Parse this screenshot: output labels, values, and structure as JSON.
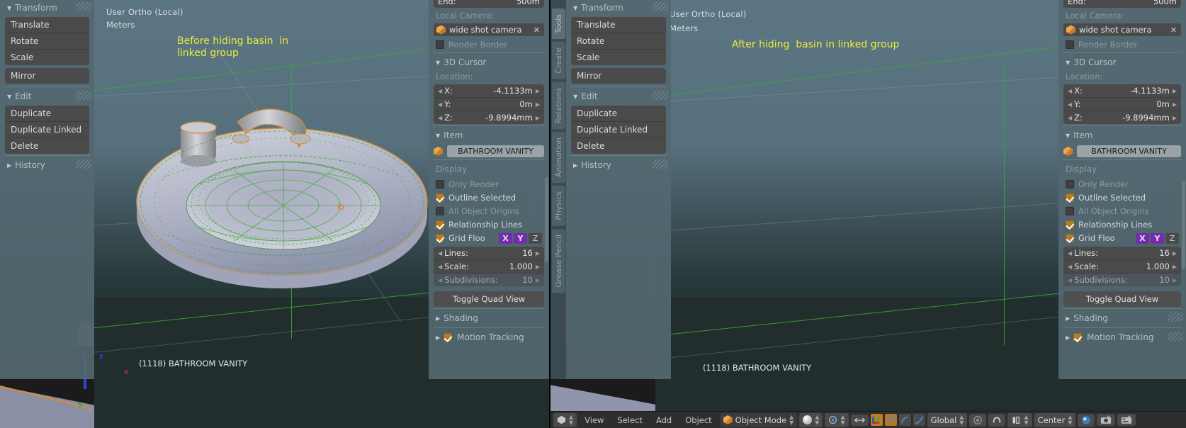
{
  "panes": [
    {
      "id": "before",
      "viewport": {
        "view_label": "User Ortho (Local)",
        "units": "Meters",
        "annotation": "Before hiding basin  in\nlinked group",
        "annotation_color": "#ecec3c",
        "object_label": "(1118) BATHROOM VANITY"
      },
      "left_panel": {
        "transform": {
          "title": "Transform",
          "buttons": [
            "Translate",
            "Rotate",
            "Scale"
          ],
          "extra_button": "Mirror"
        },
        "edit": {
          "title": "Edit",
          "buttons": [
            "Duplicate",
            "Duplicate Linked",
            "Delete"
          ]
        },
        "history": {
          "title": "History"
        }
      },
      "right_panel": {
        "clip_end": {
          "label": "End:",
          "value": "500m"
        },
        "local_camera": {
          "label": "Local Camera:",
          "value": "wide shot camera"
        },
        "render_border": {
          "label": "Render Border",
          "checked": false
        },
        "cursor": {
          "title": "3D Cursor",
          "location_label": "Location:",
          "fields": [
            {
              "label": "X:",
              "value": "-4.1133m"
            },
            {
              "label": "Y:",
              "value": "0m"
            },
            {
              "label": "Z:",
              "value": "-9.8994mm"
            }
          ]
        },
        "item": {
          "title": "Item",
          "name": "BATHROOM VANITY"
        },
        "display": {
          "title": "Display",
          "checks": [
            {
              "label": "Only Render",
              "checked": false,
              "dim": true
            },
            {
              "label": "Outline Selected",
              "checked": true,
              "dim": false
            },
            {
              "label": "All Object Origins",
              "checked": false,
              "dim": true
            },
            {
              "label": "Relationship Lines",
              "checked": true,
              "dim": false
            }
          ],
          "grid_floor": {
            "label": "Grid Floo",
            "checked": true,
            "axes": [
              "X",
              "Y",
              "Z"
            ],
            "axes_on": [
              "X",
              "Y"
            ]
          },
          "fields": [
            {
              "label": "Lines:",
              "value": "16",
              "dim": false
            },
            {
              "label": "Scale:",
              "value": "1.000",
              "dim": false
            },
            {
              "label": "Subdivisions:",
              "value": "10",
              "dim": true
            }
          ],
          "toggle_quad_view": "Toggle Quad View"
        },
        "shading": {
          "title": "Shading"
        },
        "motion_tracking": {
          "title": "Motion Tracking",
          "checked": true
        }
      }
    },
    {
      "id": "after",
      "viewport": {
        "view_label": "User Ortho (Local)",
        "units": "Meters",
        "annotation": "After hiding  basin in linked group",
        "annotation_color": "#ecec3c",
        "object_label": "(1118) BATHROOM VANITY"
      },
      "tabs": [
        {
          "label": "Tools",
          "active": true
        },
        {
          "label": "Create",
          "active": false
        },
        {
          "label": "Relations",
          "active": false
        },
        {
          "label": "Animation",
          "active": false
        },
        {
          "label": "Physics",
          "active": false
        },
        {
          "label": "Grease Pencil",
          "active": false
        }
      ],
      "left_panel": {
        "transform": {
          "title": "Transform",
          "buttons": [
            "Translate",
            "Rotate",
            "Scale"
          ],
          "extra_button": "Mirror"
        },
        "edit": {
          "title": "Edit",
          "buttons": [
            "Duplicate",
            "Duplicate Linked",
            "Delete"
          ]
        },
        "history": {
          "title": "History"
        }
      },
      "right_panel": {
        "clip_end": {
          "label": "End:",
          "value": "500m"
        },
        "local_camera": {
          "label": "Local Camera:",
          "value": "wide shot camera"
        },
        "render_border": {
          "label": "Render Border",
          "checked": false
        },
        "cursor": {
          "title": "3D Cursor",
          "location_label": "Location:",
          "fields": [
            {
              "label": "X:",
              "value": "-4.1133m"
            },
            {
              "label": "Y:",
              "value": "0m"
            },
            {
              "label": "Z:",
              "value": "-9.8994mm"
            }
          ]
        },
        "item": {
          "title": "Item",
          "name": "BATHROOM VANITY"
        },
        "display": {
          "title": "Display",
          "checks": [
            {
              "label": "Only Render",
              "checked": false,
              "dim": true
            },
            {
              "label": "Outline Selected",
              "checked": true,
              "dim": false
            },
            {
              "label": "All Object Origins",
              "checked": false,
              "dim": true
            },
            {
              "label": "Relationship Lines",
              "checked": true,
              "dim": false
            }
          ],
          "grid_floor": {
            "label": "Grid Floo",
            "checked": true,
            "axes": [
              "X",
              "Y",
              "Z"
            ],
            "axes_on": [
              "X",
              "Y"
            ]
          },
          "fields": [
            {
              "label": "Lines:",
              "value": "16",
              "dim": false
            },
            {
              "label": "Scale:",
              "value": "1.000",
              "dim": false
            },
            {
              "label": "Subdivisions:",
              "value": "10",
              "dim": true
            }
          ],
          "toggle_quad_view": "Toggle Quad View"
        },
        "shading": {
          "title": "Shading"
        },
        "motion_tracking": {
          "title": "Motion Tracking",
          "checked": true
        }
      },
      "toolbar": {
        "menus": [
          "View",
          "Select",
          "Add",
          "Object"
        ],
        "mode": "Object Mode",
        "pivot": "Center",
        "transform_orientation": "Global"
      }
    }
  ]
}
